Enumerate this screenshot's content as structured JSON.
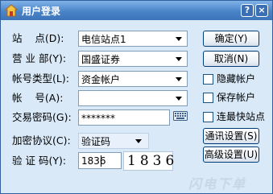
{
  "window": {
    "title": "用户登录",
    "help_glyph": "?",
    "close_glyph": "×",
    "accent": "#4a84c9",
    "background": "#d9e9f8"
  },
  "form": {
    "site": {
      "label": "站    点(D):",
      "value": "电信站点1"
    },
    "broker": {
      "label": "营 业 部(Y):",
      "value": "国盛证券"
    },
    "account_type": {
      "label": "帐号类型(L):",
      "value": "资金帐户"
    },
    "account": {
      "label": "帐    号(A):",
      "value": ""
    },
    "password": {
      "label": "交易密码(G):",
      "value": "*******"
    },
    "protocol": {
      "label": "加密协议(C):",
      "value": "验证码"
    },
    "verify": {
      "label": "验 证 码(Y):",
      "value": "1836",
      "captcha": "1836"
    }
  },
  "buttons": {
    "ok": "确定(Y)",
    "cancel": "取消(N)",
    "comm": "通讯设置(S)",
    "advanced": "高级设置(U)"
  },
  "options": {
    "hide_account": "隐藏帐户",
    "save_account": "保存帐户",
    "fastest_site": "连最快站点"
  },
  "icons": {
    "app": "house-icon",
    "keyboard": "keyboard-icon"
  },
  "watermark": "闪电下单"
}
